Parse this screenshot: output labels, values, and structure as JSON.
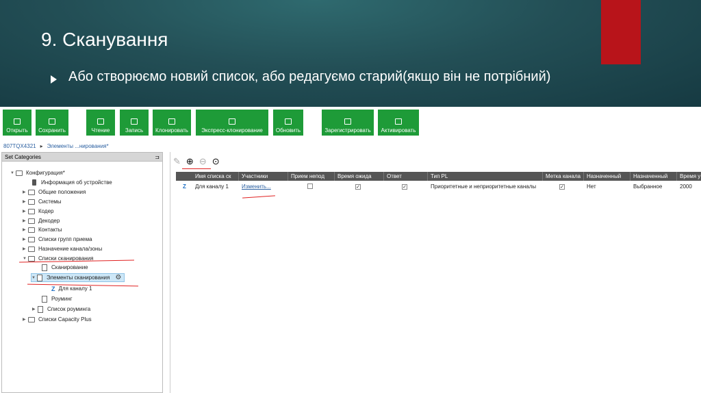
{
  "slide": {
    "title": "9. Сканування",
    "bullet": "Або створюємо новий список, або редагуємо старий(якщо він не потрібний)"
  },
  "toolbar": {
    "buttons": [
      {
        "label": "Открыть",
        "icon": "folder-icon"
      },
      {
        "label": "Сохранить",
        "icon": "save-icon"
      },
      {
        "label": "Чтение",
        "icon": "read-icon"
      },
      {
        "label": "Запись",
        "icon": "write-icon"
      },
      {
        "label": "Клонировать",
        "icon": "clone-icon"
      },
      {
        "label": "Экспресс-клонирование",
        "icon": "express-clone-icon"
      },
      {
        "label": "Обновить",
        "icon": "update-icon"
      },
      {
        "label": "Зарегистрировать",
        "icon": "star-icon"
      },
      {
        "label": "Активировать",
        "icon": "activate-icon"
      }
    ],
    "color": "#1e9b38"
  },
  "breadcrumb": {
    "device": "807TQX4321",
    "section": "Элементы ...нирования*"
  },
  "tree": {
    "header": "Set Categories",
    "items": [
      "Конфигурация*",
      "Информация об устройстве",
      "Общие положения",
      "Системы",
      "Кодер",
      "Декодер",
      "Контакты",
      "Списки групп приема",
      "Назначение канала/зоны",
      "Списки сканирования",
      "Сканирование",
      "Элементы сканирования",
      "Для каналу 1",
      "Роуминг",
      "Список роуминга",
      "Списки Capacity Plus"
    ]
  },
  "grid": {
    "columns": [
      "Имя списка ск",
      "Участники",
      "Прием непод",
      "Время ожида",
      "Ответ",
      "Тип PL",
      "Метка канала",
      "Назначенный",
      "Назначенный",
      "Время у"
    ],
    "row": {
      "name": "Для каналу 1",
      "members": "Изменить...",
      "pl_type": "Приоритетные и неприоритетные каналы",
      "assigned1": "Нет",
      "assigned2": "Выбранное",
      "time": "2000"
    }
  },
  "colors": {
    "accent_green": "#1e9b38",
    "slide_red": "#b8141a",
    "annotation": "#e02020"
  }
}
